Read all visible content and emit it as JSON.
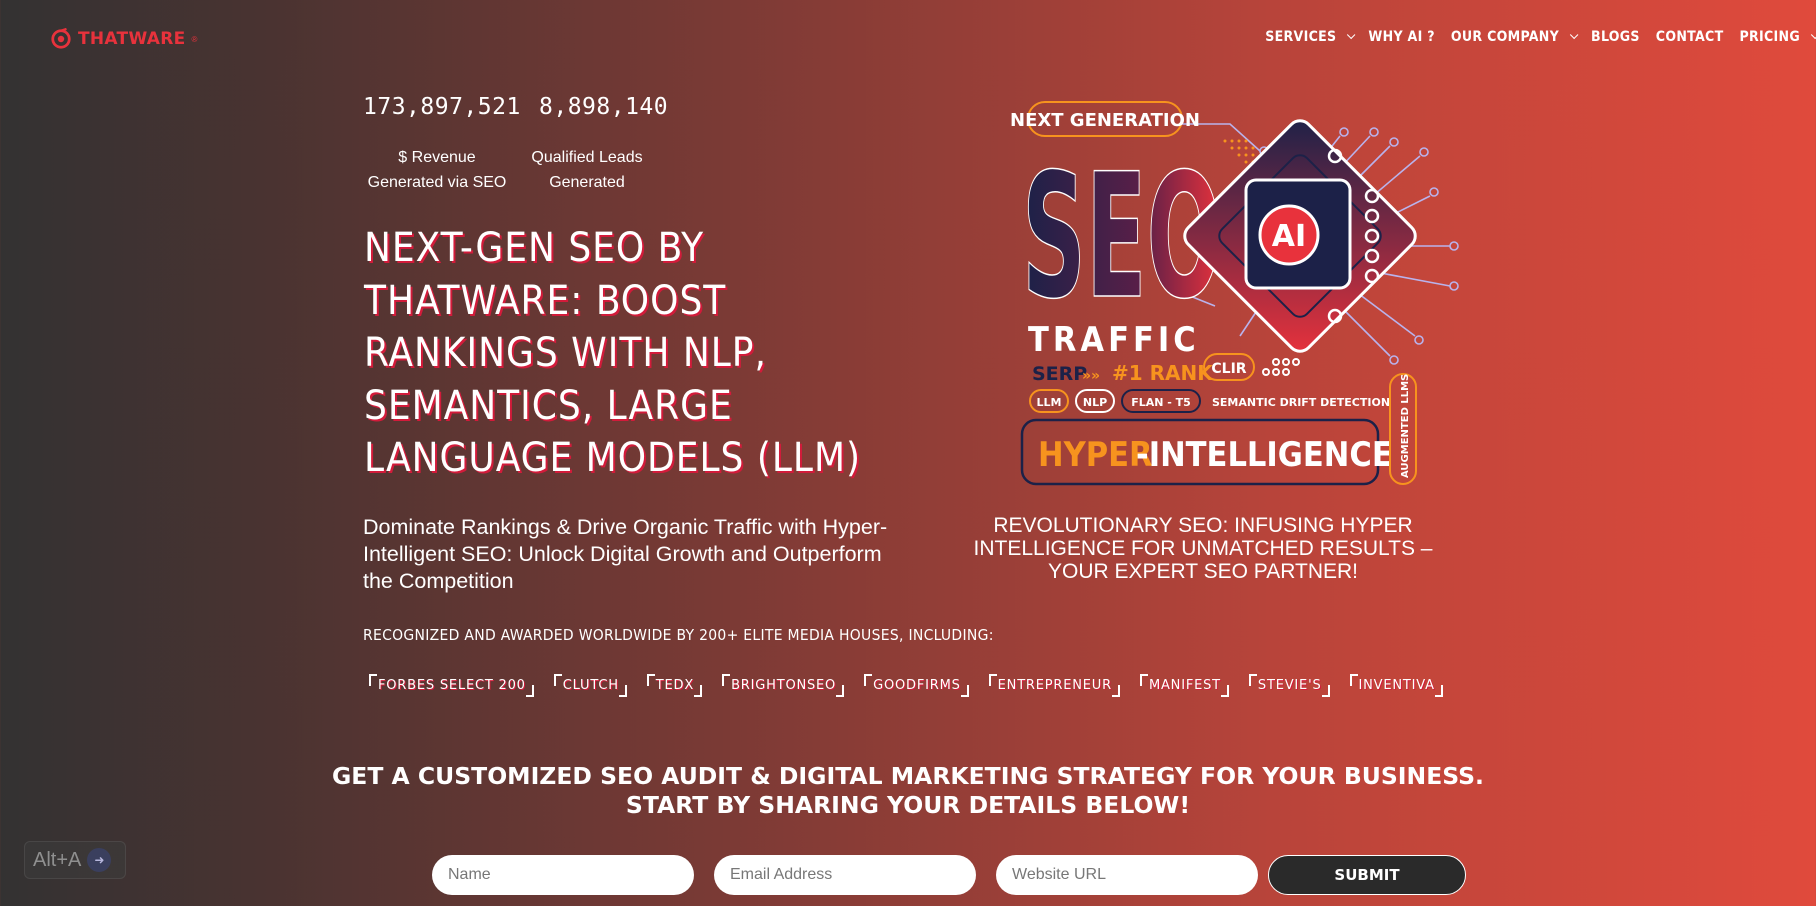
{
  "brand": {
    "name": "THATWARE",
    "reg": "®"
  },
  "nav": [
    {
      "label": "SERVICES",
      "dropdown": true
    },
    {
      "label": "WHY AI ?",
      "dropdown": false
    },
    {
      "label": "OUR COMPANY",
      "dropdown": true
    },
    {
      "label": "BLOGS",
      "dropdown": false
    },
    {
      "label": "CONTACT",
      "dropdown": false
    },
    {
      "label": "PRICING",
      "dropdown": true
    }
  ],
  "stats": [
    {
      "value": "173,897,521",
      "label1": "$ Revenue",
      "label2": "Generated via SEO"
    },
    {
      "value": "8,898,140",
      "label1": "Qualified Leads",
      "label2": "Generated"
    }
  ],
  "headline": "NEXT-GEN SEO BY THATWARE: BOOST RANKINGS WITH NLP, SEMANTICS, LARGE LANGUAGE MODELS (LLM)",
  "subheadline": "Dominate Rankings & Drive Organic Traffic with Hyper-Intelligent SEO: Unlock Digital Growth and Outperform the Competition",
  "hero": {
    "badge": "NEXT GENERATION",
    "big": "SEO",
    "chip": "AI",
    "traffic": "TRAFFIC",
    "serp": "SERP",
    "rank": "#1 RANK",
    "clir": "CLIR",
    "pills": [
      "LLM",
      "NLP",
      "FLAN - T5"
    ],
    "semantic": "SEMANTIC DRIFT DETECTION",
    "hyper1": "HYPER",
    "hyper2": "-INTELLIGENCE",
    "augmented": "AUGMENTED LLMS",
    "caption": "REVOLUTIONARY SEO: INFUSING HYPER INTELLIGENCE FOR UNMATCHED RESULTS – YOUR EXPERT SEO PARTNER!"
  },
  "recognition": "RECOGNIZED AND AWARDED WORLDWIDE BY 200+ ELITE MEDIA HOUSES, INCLUDING:",
  "badges": [
    "FORBES SELECT 200",
    "CLUTCH",
    "TEDX",
    "BRIGHTONSEO",
    "GOODFIRMS",
    "ENTREPRENEUR",
    "MANIFEST",
    "STEVIE'S",
    "INVENTIVA"
  ],
  "cta": {
    "line1": "GET A CUSTOMIZED SEO AUDIT & DIGITAL MARKETING STRATEGY FOR YOUR BUSINESS.",
    "line2": "START BY SHARING YOUR DETAILS BELOW!"
  },
  "form": {
    "name_placeholder": "Name",
    "email_placeholder": "Email Address",
    "url_placeholder": "Website URL",
    "submit_label": "SUBMIT"
  },
  "shortcut": {
    "label": "Alt+A"
  },
  "colors": {
    "accent": "#e8323c",
    "orange": "#f7931e",
    "navy": "#1c2148"
  }
}
